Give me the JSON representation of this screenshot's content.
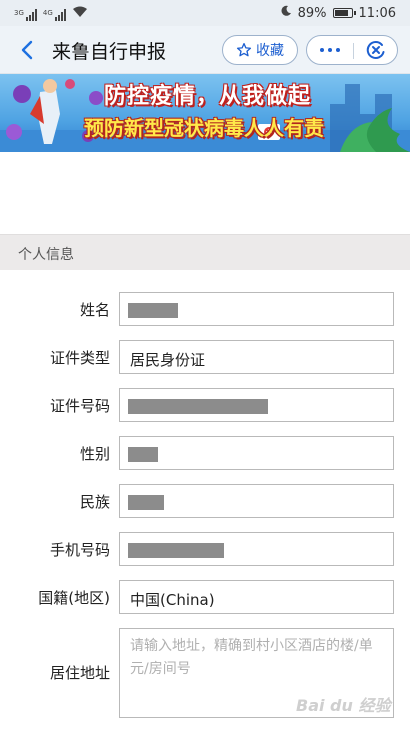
{
  "status_bar": {
    "net_tag_1": "3G",
    "net_tag_2": "4G",
    "battery": "89%",
    "battery_level": 0.89,
    "time": "11:06"
  },
  "nav": {
    "title": "来鲁自行申报",
    "favorite_label": "收藏",
    "back_icon": "chevron-left-icon",
    "more_icon": "more-dots-icon",
    "close_icon": "close-circle-icon",
    "accent_color": "#1d5fd0"
  },
  "banner": {
    "title": "防控疫情，从我做起",
    "subtitle": "预防新型冠状病毒人人有责"
  },
  "section": {
    "title": "个人信息"
  },
  "form": {
    "name": {
      "label": "姓名",
      "value": ""
    },
    "id_type": {
      "label": "证件类型",
      "value": "居民身份证"
    },
    "id_number": {
      "label": "证件号码",
      "value": ""
    },
    "gender": {
      "label": "性别",
      "value": ""
    },
    "ethnicity": {
      "label": "民族",
      "value": ""
    },
    "phone": {
      "label": "手机号码",
      "value": ""
    },
    "nationality": {
      "label": "国籍(地区)",
      "value": "中国(China)"
    },
    "address": {
      "label": "居住地址",
      "value": "",
      "placeholder": "请输入地址，精确到村小区酒店的楼/单元/房间号"
    }
  },
  "watermark": "Bai du 经验"
}
